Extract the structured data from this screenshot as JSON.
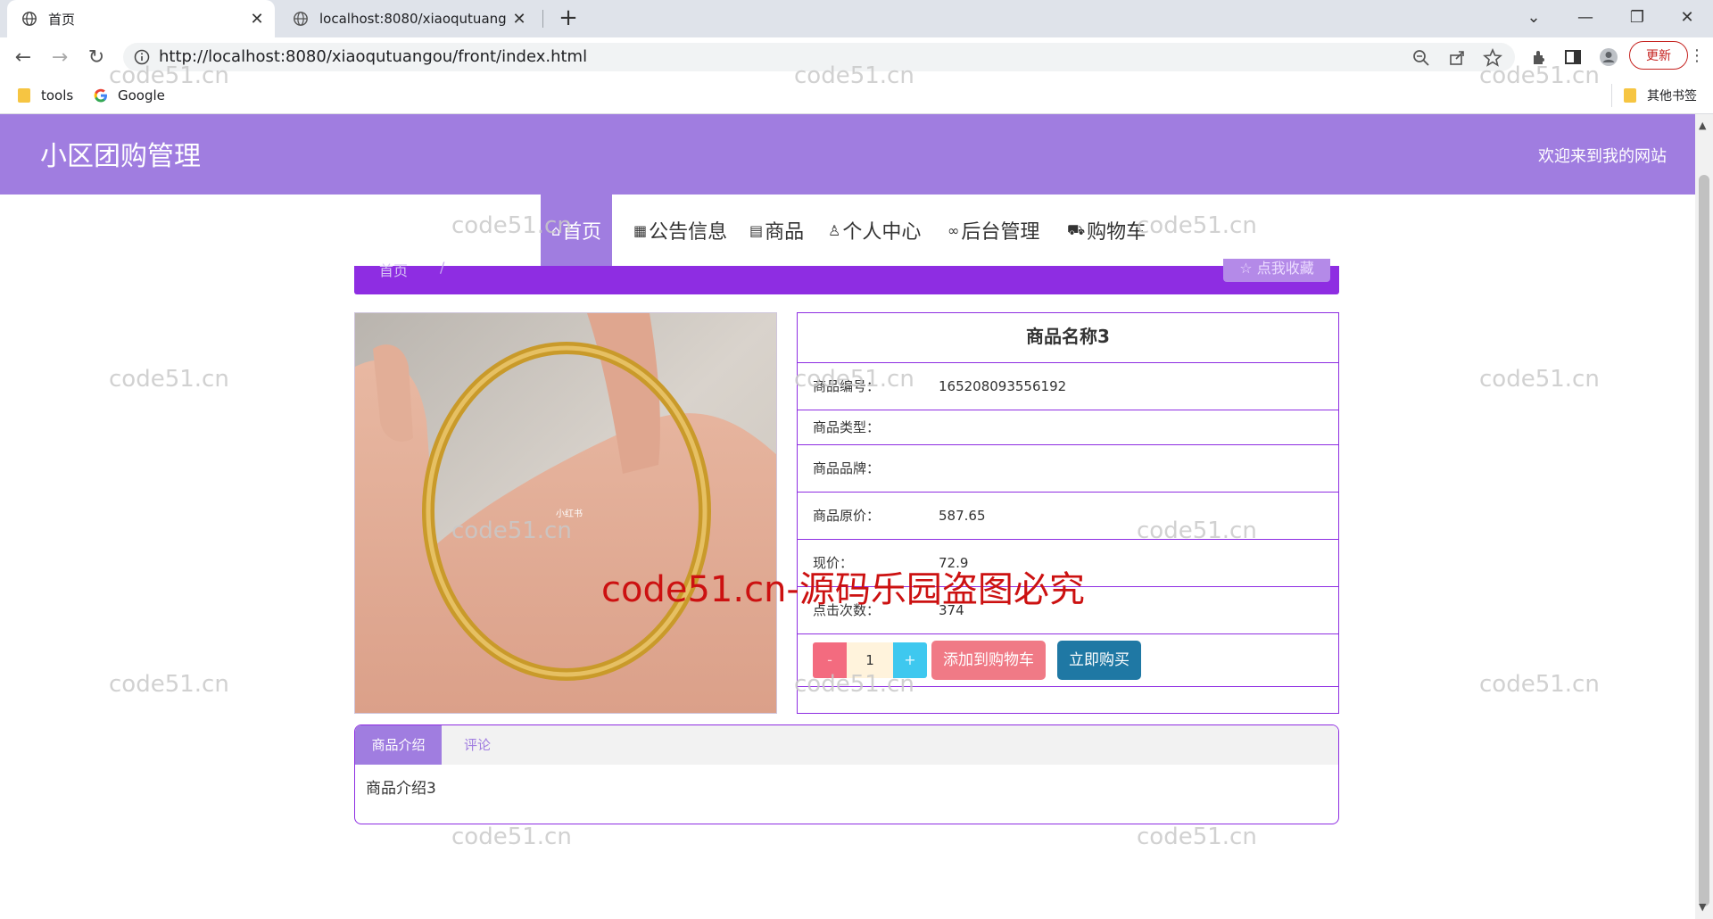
{
  "browser": {
    "tabs": [
      {
        "title": "首页",
        "active": true
      },
      {
        "title": "localhost:8080/xiaoqutuangou",
        "active": false
      }
    ],
    "url": "http://localhost:8080/xiaoqutuangou/front/index.html",
    "update_label": "更新",
    "bookmarks": [
      {
        "label": "tools",
        "icon": "folder-icon"
      },
      {
        "label": "Google",
        "icon": "google-icon"
      }
    ],
    "other_bookmarks": "其他书签"
  },
  "site": {
    "title": "小区团购管理",
    "welcome": "欢迎来到我的网站",
    "accent": "#a07de0"
  },
  "nav": {
    "items": [
      {
        "label": "首页",
        "icon": "home-icon",
        "active": true
      },
      {
        "label": "公告信息",
        "icon": "grid-icon"
      },
      {
        "label": "商品",
        "icon": "document-icon"
      },
      {
        "label": "个人中心",
        "icon": "user-icon"
      },
      {
        "label": "后台管理",
        "icon": "link-icon"
      },
      {
        "label": "购物车",
        "icon": "cart-icon"
      }
    ]
  },
  "breadcrumb": {
    "home": "首页",
    "separator": "/",
    "favorite_label": "☆ 点我收藏"
  },
  "product": {
    "image_caption": "小红书",
    "name": "商品名称3",
    "fields": [
      {
        "label": "商品编号：",
        "value": "165208093556192"
      },
      {
        "label": "商品类型：",
        "value": ""
      },
      {
        "label": "商品品牌：",
        "value": ""
      },
      {
        "label": "商品原价：",
        "value": "587.65"
      },
      {
        "label": "现价：",
        "value": "72.9"
      },
      {
        "label": "点击次数：",
        "value": "374"
      }
    ],
    "quantity": "1",
    "minus_label": "-",
    "plus_label": "+",
    "add_to_cart_label": "添加到购物车",
    "buy_now_label": "立即购买"
  },
  "detail_tabs": {
    "tabs": [
      "商品介绍",
      "评论"
    ],
    "content": "商品介绍3"
  },
  "watermark": {
    "text": "code51.cn",
    "banner": "code51.cn-源码乐园盗图必究"
  }
}
